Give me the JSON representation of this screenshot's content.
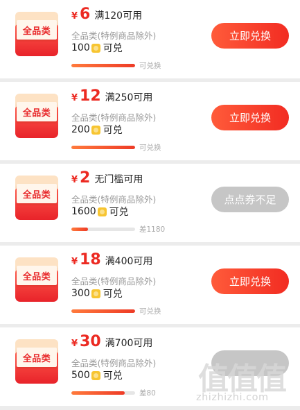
{
  "coupons": [
    {
      "currency": "¥",
      "amount": "6",
      "condition": "满120可用",
      "scope": "全品类(特例商品除外)",
      "points_cost": "100",
      "cost_suffix": "可兑",
      "progress": 1.0,
      "progress_label": "可兑换",
      "badge_label": "全品类",
      "button_label": "立即兑换",
      "button_state": "active"
    },
    {
      "currency": "¥",
      "amount": "12",
      "condition": "满250可用",
      "scope": "全品类(特例商品除外)",
      "points_cost": "200",
      "cost_suffix": "可兑",
      "progress": 1.0,
      "progress_label": "可兑换",
      "badge_label": "全品类",
      "button_label": "立即兑换",
      "button_state": "active"
    },
    {
      "currency": "¥",
      "amount": "2",
      "condition": "无门槛可用",
      "scope": "全品类(特例商品除外)",
      "points_cost": "1600",
      "cost_suffix": "可兑",
      "progress": 0.26,
      "progress_label": "差1180",
      "badge_label": "全品类",
      "button_label": "点点券不足",
      "button_state": "disabled"
    },
    {
      "currency": "¥",
      "amount": "18",
      "condition": "满400可用",
      "scope": "全品类(特例商品除外)",
      "points_cost": "300",
      "cost_suffix": "可兑",
      "progress": 1.0,
      "progress_label": "可兑换",
      "badge_label": "全品类",
      "button_label": "立即兑换",
      "button_state": "active"
    },
    {
      "currency": "¥",
      "amount": "30",
      "condition": "满700可用",
      "scope": "全品类(特例商品除外)",
      "points_cost": "500",
      "cost_suffix": "可兑",
      "progress": 0.84,
      "progress_label": "差80",
      "badge_label": "全品类",
      "button_label": "",
      "button_state": "disabled"
    }
  ],
  "colors": {
    "accent": "#ec2a22",
    "button_active": "#f22c22",
    "button_disabled": "#c6c6c6",
    "coin": "#f7c531"
  },
  "icons": {
    "badge": "red-envelope-coupon-icon",
    "coin": "points-coin-icon"
  },
  "watermark": {
    "glyphs": "值值值",
    "site": "zhizhizhi.com"
  }
}
